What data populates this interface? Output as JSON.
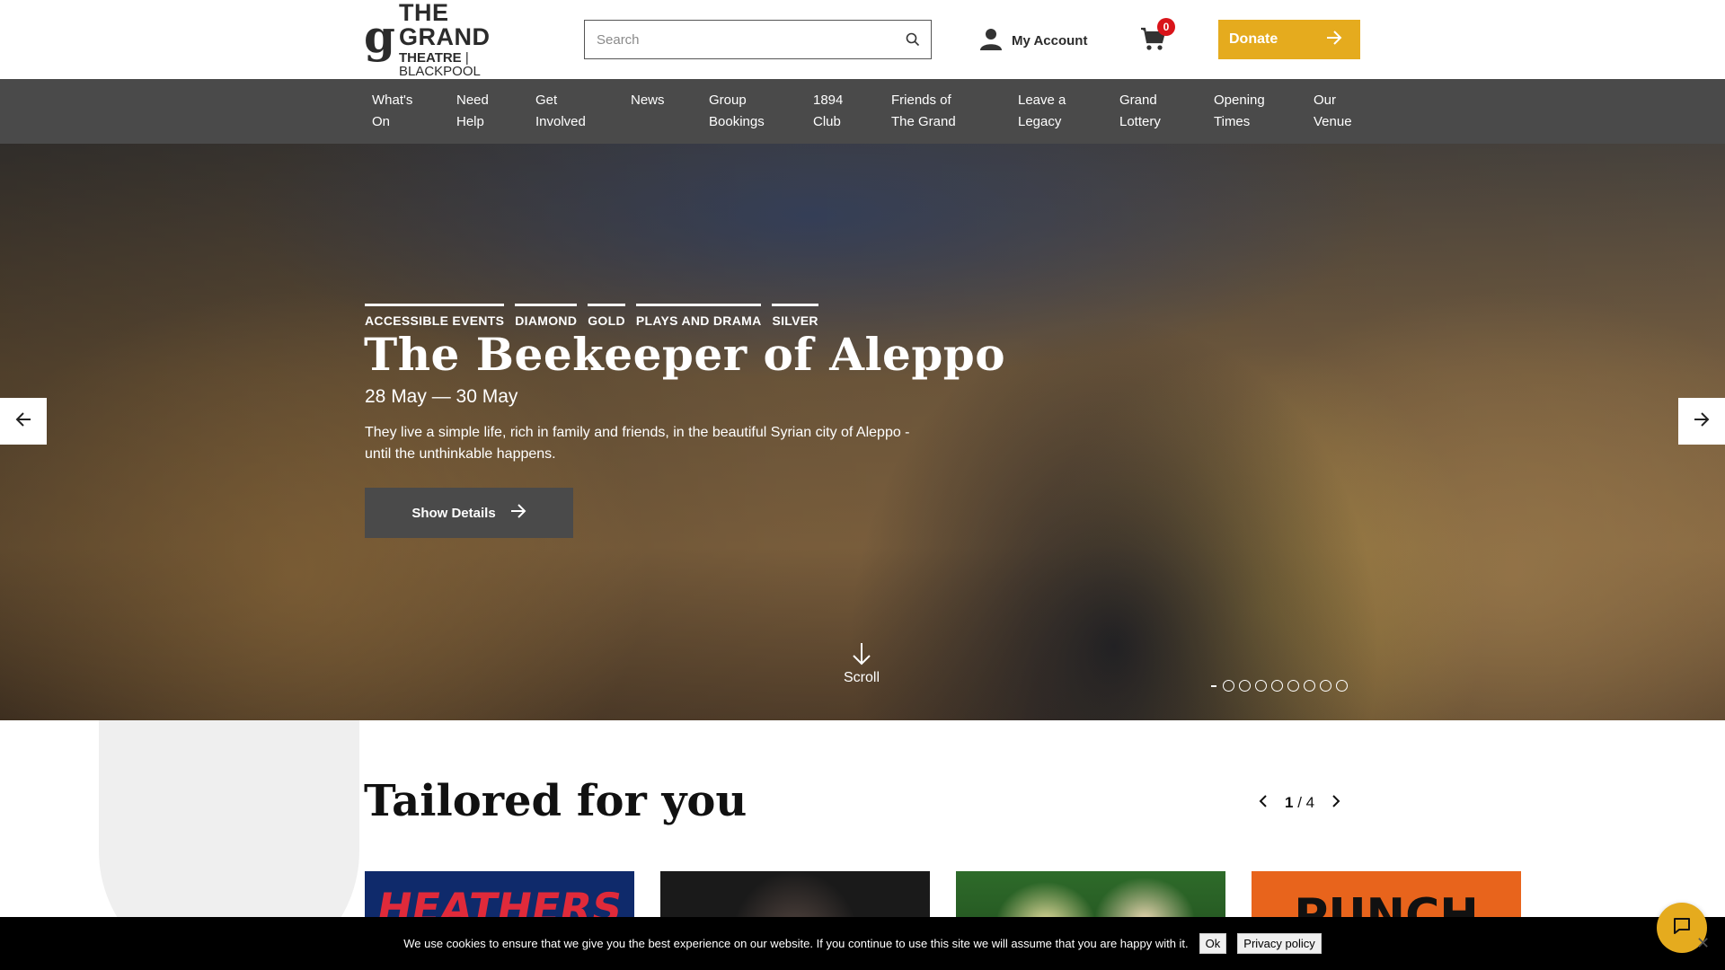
{
  "brand": {
    "logo_line1": "THE GRAND",
    "logo_line2a": "THEATRE",
    "logo_line2b": "BLACKPOOL",
    "accent": "#e5ab1e",
    "nav_bg": "#4a4a4a"
  },
  "header": {
    "search_placeholder": "Search",
    "account_label": "My Account",
    "cart_count": "0",
    "donate_label": "Donate"
  },
  "nav": {
    "items": [
      {
        "l1": "What's",
        "l2": "On"
      },
      {
        "l1": "Need",
        "l2": "Help"
      },
      {
        "l1": "Get",
        "l2": "Involved"
      },
      {
        "l1": "News",
        "l2": ""
      },
      {
        "l1": "Group",
        "l2": "Bookings"
      },
      {
        "l1": "1894",
        "l2": "Club"
      },
      {
        "l1": "Friends of",
        "l2": "The Grand"
      },
      {
        "l1": "Leave a",
        "l2": "Legacy"
      },
      {
        "l1": "Grand",
        "l2": "Lottery"
      },
      {
        "l1": "Opening",
        "l2": "Times"
      },
      {
        "l1": "Our",
        "l2": "Venue"
      }
    ]
  },
  "hero": {
    "tags": [
      "ACCESSIBLE EVENTS",
      "DIAMOND",
      "GOLD",
      "PLAYS AND DRAMA",
      "SILVER"
    ],
    "title": "The Beekeeper of Aleppo",
    "dates": "28 May — 30 May",
    "description": "They live a simple life, rich in family and friends, in the beautiful Syrian city of Aleppo - until the unthinkable happens.",
    "cta": "Show Details",
    "scroll_label": "Scroll",
    "slide_count": 8
  },
  "tailored": {
    "title": "Tailored for you",
    "page_current": "1",
    "page_total": "/ 4",
    "cards": [
      {
        "title": "HEATHERS"
      },
      {
        "title": ""
      },
      {
        "title": ""
      },
      {
        "title": "PUNCH"
      }
    ]
  },
  "cookie": {
    "text": "We use cookies to ensure that we give you the best experience on our website. If you continue to use this site we will assume that you are happy with it.",
    "ok": "Ok",
    "privacy": "Privacy policy"
  }
}
